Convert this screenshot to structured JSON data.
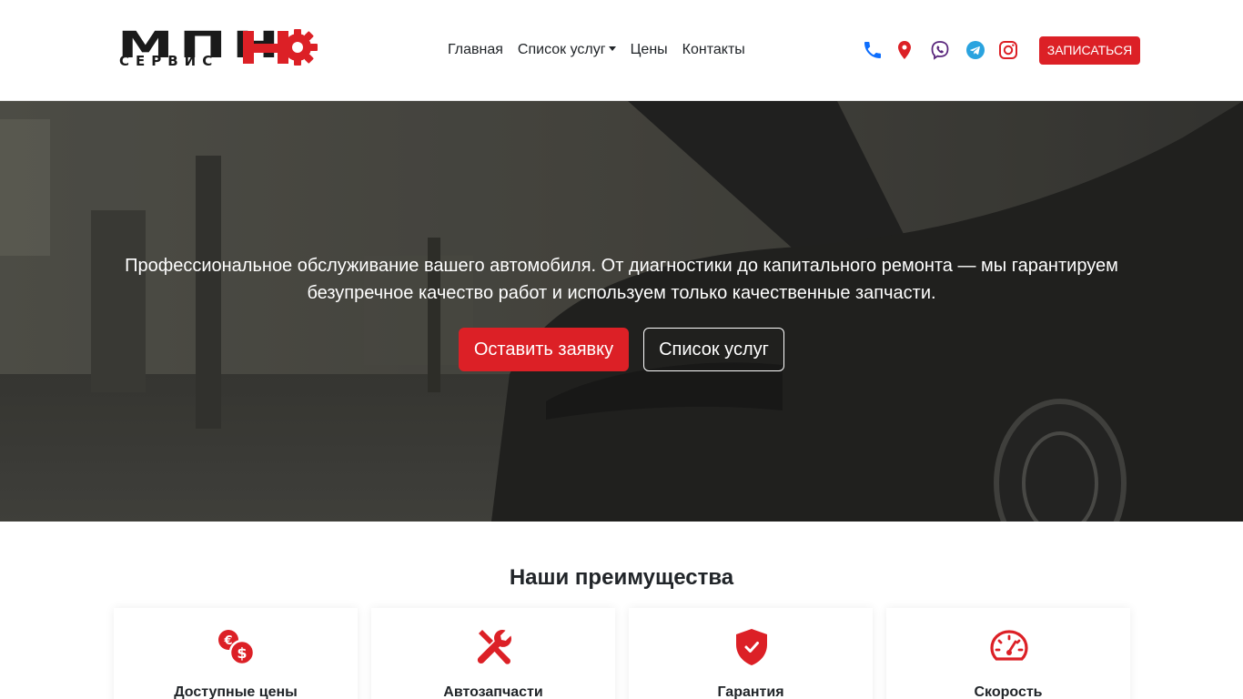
{
  "brand": {
    "logo_top": "МПН",
    "logo_bottom": "СЕРВИС",
    "accent_color": "#dc2026"
  },
  "nav": {
    "items": [
      {
        "label": "Главная"
      },
      {
        "label": "Список услуг",
        "dropdown": true
      },
      {
        "label": "Цены"
      },
      {
        "label": "Контакты"
      }
    ]
  },
  "social": [
    {
      "icon": "phone-icon",
      "color": "#0d6efd"
    },
    {
      "icon": "map-pin-icon",
      "color": "#dc2026"
    },
    {
      "icon": "viber-icon",
      "color": "#59267c"
    },
    {
      "icon": "telegram-icon",
      "color": "#2aa3df"
    },
    {
      "icon": "instagram-icon",
      "color": "#dc2026"
    }
  ],
  "header": {
    "cta_label": "ЗАПИСАТЬСЯ"
  },
  "hero": {
    "text": "Профессиональное обслуживание вашего автомобиля. От диагностики до капитального ремонта — мы гарантируем безупречное качество работ и используем только качественные запчасти.",
    "primary_button": "Оставить заявку",
    "secondary_button": "Список услуг"
  },
  "advantages": {
    "title": "Наши преимущества",
    "items": [
      {
        "title": "Доступные цены",
        "icon": "currency-coins-icon"
      },
      {
        "title": "Автозапчасти",
        "icon": "tools-icon"
      },
      {
        "title": "Гарантия",
        "icon": "shield-check-icon"
      },
      {
        "title": "Скорость",
        "icon": "speedometer-icon"
      }
    ]
  }
}
